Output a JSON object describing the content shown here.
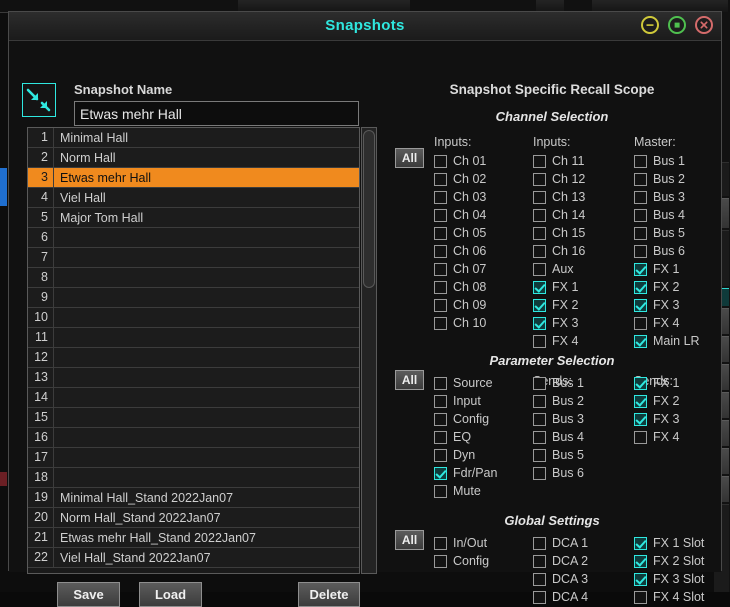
{
  "window": {
    "title": "Snapshots",
    "controls": [
      {
        "name": "minimize",
        "glyph": "minus",
        "color": "#cfc93a"
      },
      {
        "name": "maximize",
        "glyph": "square",
        "color": "#4fc04f"
      },
      {
        "name": "close",
        "glyph": "x",
        "color": "#d46b6b"
      }
    ]
  },
  "left": {
    "icon_name": "snapshot-arrows-icon",
    "name_label": "Snapshot Name",
    "name_value": "Etwas mehr Hall",
    "name_placeholder": "Snapshot Name",
    "selected_index": 3,
    "rows": [
      {
        "n": "1",
        "name": "Minimal Hall"
      },
      {
        "n": "2",
        "name": "Norm Hall"
      },
      {
        "n": "3",
        "name": "Etwas mehr Hall"
      },
      {
        "n": "4",
        "name": "Viel Hall"
      },
      {
        "n": "5",
        "name": "Major Tom Hall"
      },
      {
        "n": "6",
        "name": ""
      },
      {
        "n": "7",
        "name": ""
      },
      {
        "n": "8",
        "name": ""
      },
      {
        "n": "9",
        "name": ""
      },
      {
        "n": "10",
        "name": ""
      },
      {
        "n": "11",
        "name": ""
      },
      {
        "n": "12",
        "name": ""
      },
      {
        "n": "13",
        "name": ""
      },
      {
        "n": "14",
        "name": ""
      },
      {
        "n": "15",
        "name": ""
      },
      {
        "n": "16",
        "name": ""
      },
      {
        "n": "17",
        "name": ""
      },
      {
        "n": "18",
        "name": ""
      },
      {
        "n": "19",
        "name": "Minimal Hall_Stand 2022Jan07"
      },
      {
        "n": "20",
        "name": "Norm Hall_Stand 2022Jan07"
      },
      {
        "n": "21",
        "name": "Etwas mehr Hall_Stand 2022Jan07"
      },
      {
        "n": "22",
        "name": "Viel Hall_Stand 2022Jan07"
      }
    ],
    "buttons": {
      "save": "Save",
      "load": "Load",
      "delete": "Delete"
    }
  },
  "right": {
    "heading": "Snapshot Specific Recall Scope",
    "all_label": "All",
    "sections": [
      {
        "id": "channel",
        "title": "Channel Selection",
        "columns": [
          {
            "label": "Inputs:",
            "items": [
              {
                "label": "Ch 01",
                "checked": false
              },
              {
                "label": "Ch 02",
                "checked": false
              },
              {
                "label": "Ch 03",
                "checked": false
              },
              {
                "label": "Ch 04",
                "checked": false
              },
              {
                "label": "Ch 05",
                "checked": false
              },
              {
                "label": "Ch 06",
                "checked": false
              },
              {
                "label": "Ch 07",
                "checked": false
              },
              {
                "label": "Ch 08",
                "checked": false
              },
              {
                "label": "Ch 09",
                "checked": false
              },
              {
                "label": "Ch 10",
                "checked": false
              }
            ]
          },
          {
            "label": "Inputs:",
            "items": [
              {
                "label": "Ch 11",
                "checked": false
              },
              {
                "label": "Ch 12",
                "checked": false
              },
              {
                "label": "Ch 13",
                "checked": false
              },
              {
                "label": "Ch 14",
                "checked": false
              },
              {
                "label": "Ch 15",
                "checked": false
              },
              {
                "label": "Ch 16",
                "checked": false
              },
              {
                "label": "Aux",
                "checked": false
              },
              {
                "label": "FX 1",
                "checked": true
              },
              {
                "label": "FX 2",
                "checked": true
              },
              {
                "label": "FX 3",
                "checked": true
              },
              {
                "label": "FX 4",
                "checked": false
              }
            ]
          },
          {
            "label": "Master:",
            "items": [
              {
                "label": "Bus 1",
                "checked": false
              },
              {
                "label": "Bus 2",
                "checked": false
              },
              {
                "label": "Bus 3",
                "checked": false
              },
              {
                "label": "Bus 4",
                "checked": false
              },
              {
                "label": "Bus 5",
                "checked": false
              },
              {
                "label": "Bus 6",
                "checked": false
              },
              {
                "label": "FX 1",
                "checked": true
              },
              {
                "label": "FX 2",
                "checked": true
              },
              {
                "label": "FX 3",
                "checked": true
              },
              {
                "label": "FX 4",
                "checked": false
              },
              {
                "label": "Main LR",
                "checked": true
              }
            ]
          }
        ]
      },
      {
        "id": "parameter",
        "title": "Parameter Selection",
        "columns": [
          {
            "label": "",
            "items": [
              {
                "label": "Source",
                "checked": false
              },
              {
                "label": "Input",
                "checked": false
              },
              {
                "label": "Config",
                "checked": false
              },
              {
                "label": "EQ",
                "checked": false
              },
              {
                "label": "Dyn",
                "checked": false
              },
              {
                "label": "Fdr/Pan",
                "checked": true
              },
              {
                "label": "Mute",
                "checked": false
              }
            ]
          },
          {
            "label": "Sends:",
            "items": [
              {
                "label": "Bus 1",
                "checked": false
              },
              {
                "label": "Bus 2",
                "checked": false
              },
              {
                "label": "Bus 3",
                "checked": false
              },
              {
                "label": "Bus 4",
                "checked": false
              },
              {
                "label": "Bus 5",
                "checked": false
              },
              {
                "label": "Bus 6",
                "checked": false
              }
            ]
          },
          {
            "label": "Sends:",
            "items": [
              {
                "label": "FX 1",
                "checked": true
              },
              {
                "label": "FX 2",
                "checked": true
              },
              {
                "label": "FX 3",
                "checked": true
              },
              {
                "label": "FX 4",
                "checked": false
              }
            ]
          }
        ]
      },
      {
        "id": "global",
        "title": "Global Settings",
        "columns": [
          {
            "label": "",
            "items": [
              {
                "label": "In/Out",
                "checked": false
              },
              {
                "label": "Config",
                "checked": false
              }
            ]
          },
          {
            "label": "",
            "items": [
              {
                "label": "DCA 1",
                "checked": false
              },
              {
                "label": "DCA 2",
                "checked": false
              },
              {
                "label": "DCA 3",
                "checked": false
              },
              {
                "label": "DCA 4",
                "checked": false
              }
            ]
          },
          {
            "label": "",
            "items": [
              {
                "label": "FX 1 Slot",
                "checked": true
              },
              {
                "label": "FX 2 Slot",
                "checked": true
              },
              {
                "label": "FX 3 Slot",
                "checked": true
              },
              {
                "label": "FX 4 Slot",
                "checked": false
              }
            ]
          }
        ]
      }
    ]
  },
  "colors": {
    "accent_cyan": "#2fe8e0",
    "selection_orange": "#f08a1e",
    "dialog_bg": "#111111",
    "titlebar_bg": "#242424"
  }
}
